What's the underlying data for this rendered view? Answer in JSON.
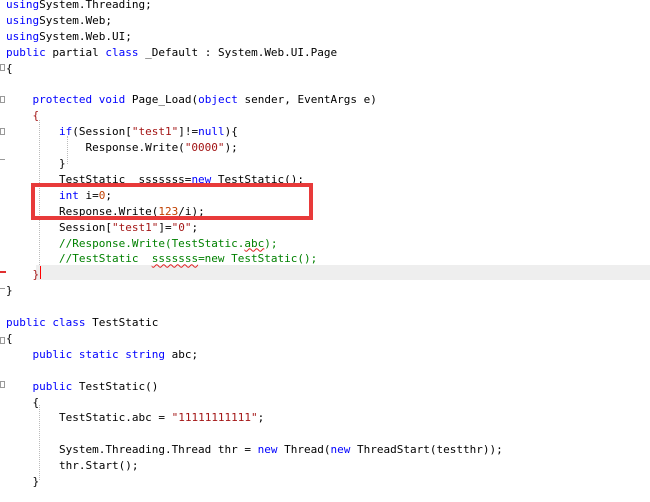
{
  "code_lines": [
    {
      "id": "l0",
      "tokens": [
        [
          "kw",
          "using"
        ],
        [
          "",
          "System.Threading;"
        ]
      ]
    },
    {
      "id": "l1",
      "tokens": [
        [
          "kw",
          "using"
        ],
        [
          "",
          "System.Web;"
        ]
      ]
    },
    {
      "id": "l2",
      "tokens": [
        [
          "kw",
          "using"
        ],
        [
          "",
          "System.Web.UI;"
        ]
      ]
    },
    {
      "id": "l3",
      "tokens": [
        [
          "kw",
          "public"
        ],
        [
          "",
          " partial "
        ],
        [
          "kw",
          "class"
        ],
        [
          "",
          " _Default : System.Web.UI.Page"
        ]
      ]
    },
    {
      "id": "l4",
      "tokens": [
        [
          "",
          "{"
        ]
      ]
    },
    {
      "id": "l5",
      "tokens": []
    },
    {
      "id": "l6",
      "tokens": [
        [
          "",
          "    "
        ],
        [
          "kw",
          "protected"
        ],
        [
          "",
          " "
        ],
        [
          "kw",
          "void"
        ],
        [
          "",
          " Page_Load("
        ],
        [
          "kw",
          "object"
        ],
        [
          "",
          " sender, EventArgs e)"
        ]
      ]
    },
    {
      "id": "l7",
      "tokens": [
        [
          "",
          "    "
        ],
        [
          "str",
          "{"
        ]
      ]
    },
    {
      "id": "l8",
      "tokens": [
        [
          "",
          "        "
        ],
        [
          "kw",
          "if"
        ],
        [
          "",
          "(Session["
        ],
        [
          "str",
          "\"test1\""
        ],
        [
          "",
          "]!="
        ],
        [
          "kw",
          "null"
        ],
        [
          "",
          "){"
        ]
      ]
    },
    {
      "id": "l9",
      "tokens": [
        [
          "",
          "            Response.Write("
        ],
        [
          "str",
          "\"0000\""
        ],
        [
          "",
          ");"
        ]
      ]
    },
    {
      "id": "l10",
      "tokens": [
        [
          "",
          "        }"
        ]
      ]
    },
    {
      "id": "l11",
      "tokens": [
        [
          "",
          "        TestStatic  sssssss="
        ],
        [
          "kw",
          "new"
        ],
        [
          "",
          " TestStatic();"
        ]
      ]
    },
    {
      "id": "l12",
      "tokens": [
        [
          "",
          "        "
        ],
        [
          "kw",
          "int"
        ],
        [
          "",
          " i="
        ],
        [
          "num",
          "0"
        ],
        [
          "",
          ";"
        ]
      ]
    },
    {
      "id": "l13",
      "tokens": [
        [
          "",
          "        Response.Write("
        ],
        [
          "num",
          "123"
        ],
        [
          "",
          "/i);"
        ]
      ]
    },
    {
      "id": "l14",
      "tokens": [
        [
          "",
          "        Session["
        ],
        [
          "str",
          "\"test1\""
        ],
        [
          "",
          "]="
        ],
        [
          "str",
          "\"0\""
        ],
        [
          "",
          ";"
        ]
      ]
    },
    {
      "id": "l15",
      "tokens": [
        [
          "cm",
          "        //Response.Write(TestStatic."
        ],
        [
          "cmsq",
          "abc"
        ],
        [
          "cm",
          ");"
        ]
      ]
    },
    {
      "id": "l16",
      "tokens": [
        [
          "cm",
          "        //TestStatic  "
        ],
        [
          "cmsq",
          "sssssss"
        ],
        [
          "cm",
          "=new TestStatic();"
        ]
      ]
    },
    {
      "id": "l17",
      "tokens": [
        [
          "",
          "    "
        ],
        [
          "str",
          "}"
        ]
      ]
    },
    {
      "id": "l18",
      "tokens": [
        [
          "",
          "}"
        ]
      ]
    },
    {
      "id": "l19",
      "tokens": []
    },
    {
      "id": "l20",
      "tokens": [
        [
          "kw",
          "public"
        ],
        [
          "",
          " "
        ],
        [
          "kw",
          "class"
        ],
        [
          "",
          " TestStatic"
        ]
      ]
    },
    {
      "id": "l21",
      "tokens": [
        [
          "",
          "{"
        ]
      ]
    },
    {
      "id": "l22",
      "tokens": [
        [
          "",
          "    "
        ],
        [
          "kw",
          "public"
        ],
        [
          "",
          " "
        ],
        [
          "kw",
          "static"
        ],
        [
          "",
          " "
        ],
        [
          "kw",
          "string"
        ],
        [
          "",
          " abc;"
        ]
      ]
    },
    {
      "id": "l23",
      "tokens": []
    },
    {
      "id": "l24",
      "tokens": [
        [
          "",
          "    "
        ],
        [
          "kw",
          "public"
        ],
        [
          "",
          " TestStatic()"
        ]
      ]
    },
    {
      "id": "l25",
      "tokens": [
        [
          "",
          "    {"
        ]
      ]
    },
    {
      "id": "l26",
      "tokens": [
        [
          "",
          "        TestStatic.abc = "
        ],
        [
          "str",
          "\"11111111111\""
        ],
        [
          "",
          ";"
        ]
      ]
    },
    {
      "id": "l27",
      "tokens": []
    },
    {
      "id": "l28",
      "tokens": [
        [
          "",
          "        System.Threading.Thread thr = "
        ],
        [
          "kw",
          "new"
        ],
        [
          "",
          " Thread("
        ],
        [
          "kw",
          "new"
        ],
        [
          "",
          " ThreadStart(testthr));"
        ]
      ]
    },
    {
      "id": "l29",
      "tokens": [
        [
          "",
          "        thr.Start();"
        ]
      ]
    },
    {
      "id": "l30",
      "tokens": [
        [
          "",
          "    }"
        ]
      ]
    }
  ]
}
